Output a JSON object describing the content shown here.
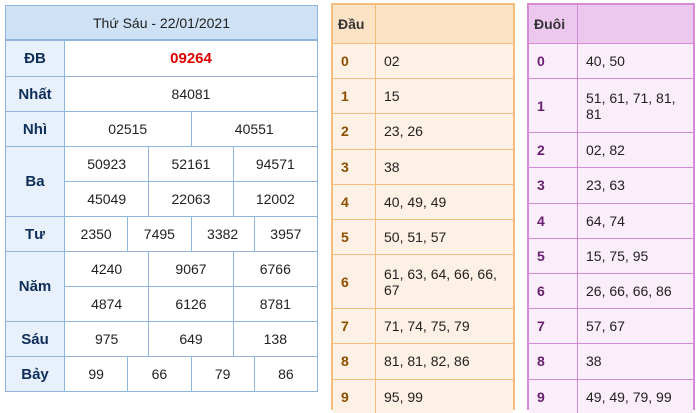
{
  "results": {
    "title": "Thứ Sáu - 22/01/2021",
    "rows": [
      {
        "label": "ĐB",
        "lines": [
          [
            "09264"
          ]
        ]
      },
      {
        "label": "Nhất",
        "lines": [
          [
            "84081"
          ]
        ]
      },
      {
        "label": "Nhì",
        "lines": [
          [
            "02515",
            "40551"
          ]
        ]
      },
      {
        "label": "Ba",
        "lines": [
          [
            "50923",
            "52161",
            "94571"
          ],
          [
            "45049",
            "22063",
            "12002"
          ]
        ]
      },
      {
        "label": "Tư",
        "lines": [
          [
            "2350",
            "7495",
            "3382",
            "3957"
          ]
        ]
      },
      {
        "label": "Năm",
        "lines": [
          [
            "4240",
            "9067",
            "6766"
          ],
          [
            "4874",
            "6126",
            "8781"
          ]
        ]
      },
      {
        "label": "Sáu",
        "lines": [
          [
            "975",
            "649",
            "138"
          ]
        ]
      },
      {
        "label": "Bảy",
        "lines": [
          [
            "99",
            "66",
            "79",
            "86"
          ]
        ]
      }
    ]
  },
  "dau": {
    "header": "Đầu",
    "rows": [
      {
        "key": "0",
        "value": "02"
      },
      {
        "key": "1",
        "value": "15"
      },
      {
        "key": "2",
        "value": "23, 26"
      },
      {
        "key": "3",
        "value": "38"
      },
      {
        "key": "4",
        "value": "40, 49, 49"
      },
      {
        "key": "5",
        "value": "50, 51, 57"
      },
      {
        "key": "6",
        "value": "61, 63, 64, 66, 66, 67"
      },
      {
        "key": "7",
        "value": "71, 74, 75, 79"
      },
      {
        "key": "8",
        "value": "81, 81, 82, 86"
      },
      {
        "key": "9",
        "value": "95, 99"
      }
    ]
  },
  "duoi": {
    "header": "Đuôi",
    "rows": [
      {
        "key": "0",
        "value": "40, 50"
      },
      {
        "key": "1",
        "value": "51, 61, 71, 81, 81"
      },
      {
        "key": "2",
        "value": "02, 82"
      },
      {
        "key": "3",
        "value": "23, 63"
      },
      {
        "key": "4",
        "value": "64, 74"
      },
      {
        "key": "5",
        "value": "15, 75, 95"
      },
      {
        "key": "6",
        "value": "26, 66, 66, 86"
      },
      {
        "key": "7",
        "value": "57, 67"
      },
      {
        "key": "8",
        "value": "38"
      },
      {
        "key": "9",
        "value": "49, 49, 79, 99"
      }
    ]
  },
  "colors": {
    "special_prize": "#e00000",
    "results_border": "#8fb5dc",
    "dau_border": "#f3bd7d",
    "duoi_border": "#d48ad6"
  }
}
